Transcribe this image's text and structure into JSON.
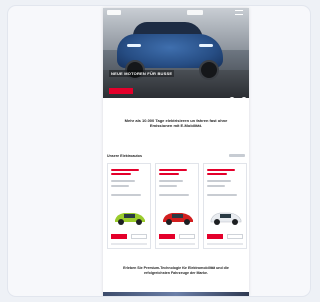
{
  "hero": {
    "caption": "NEUE MOTOREN FÜR BUSSE",
    "cta_label": "",
    "prev_arrow": "‹",
    "next_arrow": "›"
  },
  "headline": "Mehr als 10.000 Tage elektrisieren un fahren fast ohne Emissionen mit E-Mobilität.",
  "section": {
    "title": "Unsere Elektroautos"
  },
  "lower_text": "Erleben Sie Premium-Technologie für Elektromobilität und die erfolgreichsten Fahrzeuge der Marke.",
  "cars": [
    {
      "name": "car-green",
      "color": "#9bcc2e"
    },
    {
      "name": "car-red",
      "color": "#d21f1f"
    },
    {
      "name": "car-white",
      "color": "#e9ecf0"
    }
  ],
  "colors": {
    "brand_red": "#e4002b",
    "hero_blue": "#274e85"
  }
}
